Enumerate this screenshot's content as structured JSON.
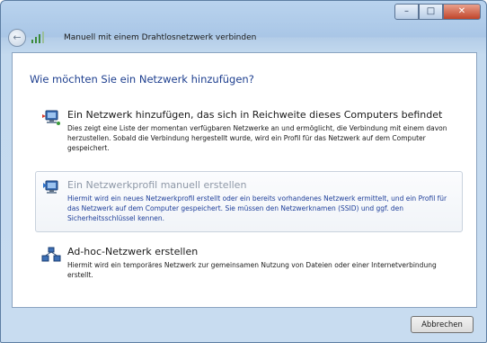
{
  "window": {
    "title": "Manuell mit einem Drahtlosnetzwerk verbinden",
    "controls": {
      "minimize": "–",
      "maximize": "□",
      "close": "✕"
    }
  },
  "nav": {
    "back_glyph": "←"
  },
  "main": {
    "heading": "Wie möchten Sie ein Netzwerk hinzufügen?",
    "options": [
      {
        "title": "Ein Netzwerk hinzufügen, das sich in Reichweite dieses Computers befindet",
        "description": "Dies zeigt eine Liste der momentan verfügbaren Netzwerke an und ermöglicht, die Verbindung mit einem davon herzustellen. Sobald die Verbindung hergestellt wurde, wird ein Profil für das Netzwerk auf dem Computer gespeichert.",
        "icon": "network-computer-icon"
      },
      {
        "title": "Ein Netzwerkprofil manuell erstellen",
        "description": "Hiermit wird ein neues Netzwerkprofil erstellt oder ein bereits vorhandenes Netzwerk ermittelt, und ein Profil für das Netzwerk auf dem Computer gespeichert. Sie müssen den Netzwerknamen (SSID) und ggf. den Sicherheitsschlüssel kennen.",
        "icon": "network-profile-icon",
        "highlighted": true
      },
      {
        "title": "Ad-hoc-Netzwerk erstellen",
        "description": "Hiermit wird ein temporäres Netzwerk zur gemeinsamen Nutzung von Dateien oder einer Internetverbindung erstellt.",
        "icon": "adhoc-network-icon"
      }
    ]
  },
  "footer": {
    "cancel_label": "Abbrechen"
  },
  "colors": {
    "heading": "#1e3f8f",
    "link_blue": "#1f3f9a",
    "frame": "#b4cde8"
  }
}
